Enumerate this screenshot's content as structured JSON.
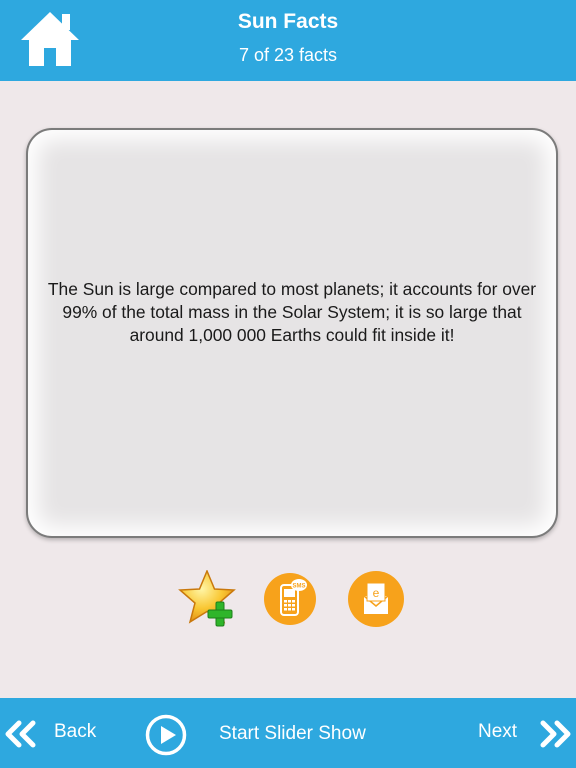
{
  "header": {
    "title": "Sun Facts",
    "subtitle": "7 of 23 facts",
    "home_icon": "home-icon",
    "background_color": "#2ea8df"
  },
  "fact": {
    "text": "The Sun is large compared to most planets; it accounts for over 99% of the total mass in the Solar System; it is so large that around 1,000 000 Earths could fit inside it!"
  },
  "actions": {
    "favorite_icon": "star-plus-icon",
    "sms_icon": "sms-phone-icon",
    "sms_icon_text": "SMS",
    "email_icon": "email-icon",
    "email_icon_text": "e",
    "accent_color": "#f7a21b"
  },
  "footer": {
    "back_label": "Back",
    "slider_label": "Start Slider Show",
    "next_label": "Next",
    "back_icon": "double-chevron-left-icon",
    "play_icon": "play-circle-icon",
    "next_icon": "double-chevron-right-icon"
  }
}
